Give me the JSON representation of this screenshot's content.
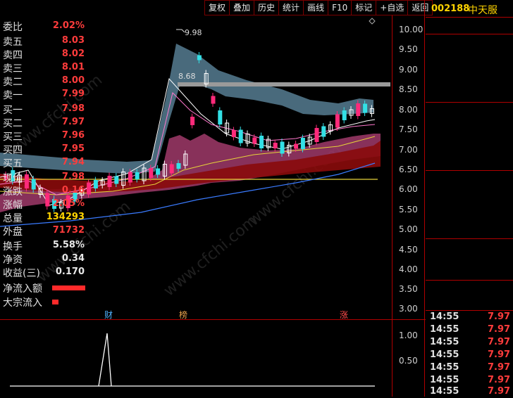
{
  "toolbar": [
    "复权",
    "叠加",
    "历史",
    "统计",
    "画线",
    "F10",
    "标记",
    "+自选",
    "返回"
  ],
  "main_chart": {
    "y_labels": [
      "10.00",
      "9.50",
      "9.00",
      "8.50",
      "8.00",
      "7.50",
      "7.00",
      "6.50",
      "6.00",
      "5.50",
      "5.00",
      "4.50",
      "4.00",
      "3.50",
      "3.00"
    ],
    "annotations": {
      "high": "9.98",
      "level": "8.68"
    },
    "events": [
      {
        "label": "财",
        "color": "#4fb3ff"
      },
      {
        "label": "榜",
        "color": "#e6a04a"
      },
      {
        "label": "涨",
        "color": "#ff4b4b"
      }
    ],
    "watermark": "www.cfchi.com"
  },
  "sub_chart": {
    "y_labels": [
      "1.00",
      "0.50"
    ]
  },
  "quote": {
    "code": "002188",
    "name": "中天服",
    "weibi": {
      "label": "委比",
      "value": "2.02%"
    },
    "asks": [
      {
        "label": "卖五",
        "price": "8.03"
      },
      {
        "label": "卖四",
        "price": "8.02"
      },
      {
        "label": "卖三",
        "price": "8.01"
      },
      {
        "label": "卖二",
        "price": "8.00"
      },
      {
        "label": "卖一",
        "price": "7.99"
      }
    ],
    "bids": [
      {
        "label": "买一",
        "price": "7.98"
      },
      {
        "label": "买二",
        "price": "7.97"
      },
      {
        "label": "买三",
        "price": "7.96"
      },
      {
        "label": "买四",
        "price": "7.95"
      },
      {
        "label": "买五",
        "price": "7.94"
      }
    ],
    "stats1": [
      {
        "label": "现价",
        "value": "7.98",
        "color": "red"
      },
      {
        "label": "涨跌",
        "value": "0.16",
        "color": "red"
      },
      {
        "label": "涨幅",
        "value": "2.05%",
        "color": "red"
      },
      {
        "label": "总量",
        "value": "134293",
        "color": "yellow"
      },
      {
        "label": "外盘",
        "value": "71732",
        "color": "red"
      }
    ],
    "stats2": [
      {
        "label": "换手",
        "value": "5.58%"
      },
      {
        "label": "净资",
        "value": "0.34"
      },
      {
        "label": "收益(三)",
        "value": "0.170"
      }
    ],
    "flows": [
      {
        "label": "净流入额",
        "fill": 0.9
      },
      {
        "label": "大宗流入",
        "fill": 0.18
      }
    ],
    "ticks": [
      {
        "time": "14:55",
        "price": "7.97"
      },
      {
        "time": "14:55",
        "price": "7.97"
      },
      {
        "time": "14:55",
        "price": "7.97"
      },
      {
        "time": "14:55",
        "price": "7.97"
      },
      {
        "time": "14:55",
        "price": "7.97"
      },
      {
        "time": "14:55",
        "price": "7.97"
      },
      {
        "time": "14:55",
        "price": "7.97"
      }
    ]
  }
}
